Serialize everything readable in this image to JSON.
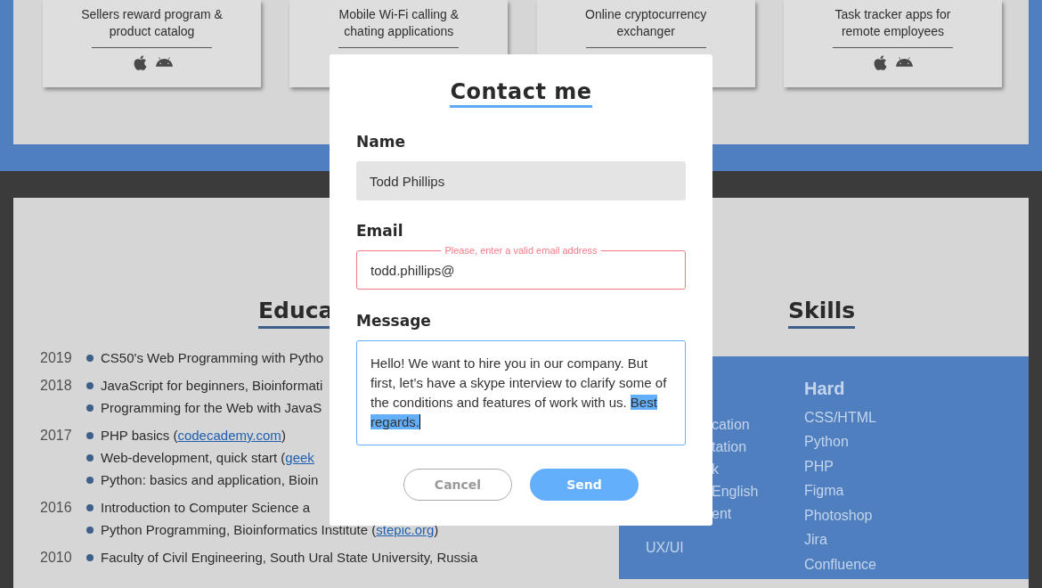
{
  "projects": [
    {
      "description": "Sellers reward program & product catalog",
      "platform_icons": true
    },
    {
      "description": "Mobile Wi-Fi calling & chating applications"
    },
    {
      "description": "Online cryptocurrency exchanger"
    },
    {
      "description": "Task tracker apps for remote employees",
      "platform_icons": true
    }
  ],
  "education": {
    "heading": "Educa",
    "entries": [
      {
        "year": "2019",
        "items": [
          {
            "text": "CS50's Web Programming with Pytho"
          }
        ]
      },
      {
        "year": "2018",
        "items": [
          {
            "text": "JavaScript for beginners, Bioinformati"
          },
          {
            "text": "Programming for the Web with JavaS"
          }
        ]
      },
      {
        "year": "2017",
        "items": [
          {
            "text": "PHP basics (",
            "link": "codecademy.com",
            "after": ")"
          },
          {
            "text": "Web-development, quick start (",
            "link": "geek"
          },
          {
            "text": "Python: basics and application, Bioin"
          }
        ]
      },
      {
        "year": "2016",
        "items": [
          {
            "text": "Introduction to Computer Science a"
          },
          {
            "text": "Python Programming, Bioinformatics Institute (",
            "link": "stepic.org",
            "after": ")"
          }
        ]
      },
      {
        "year": "2010",
        "items": [
          {
            "text": "Faculty of Civil Engineering, South Ural State University, Russia"
          }
        ]
      }
    ]
  },
  "skills": {
    "heading": "Skills",
    "soft": [
      {
        "text": "cation",
        "partial": true
      },
      {
        "text": "tation",
        "partial": true
      },
      {
        "text": "k",
        "partial": true
      },
      {
        "text": "English",
        "partial": true
      },
      {
        "text": "ent",
        "partial": true
      },
      {
        "text": "UX/UI",
        "partial": false
      }
    ],
    "hard_heading": "Hard",
    "hard": [
      "CSS/HTML",
      "Python",
      "PHP",
      "Figma",
      "Photoshop",
      "Jira",
      "Confluence"
    ]
  },
  "dialog": {
    "title": "Contact me",
    "name": {
      "label": "Name",
      "value": "Todd Phillips"
    },
    "email": {
      "label": "Email",
      "value": "todd.phillips@",
      "invalid": true,
      "error": "Please, enter a valid email address"
    },
    "message": {
      "label": "Message",
      "value": "Hello! We want to hire you in our company. But first, let’s have a skype interview to clarify some of the conditions and features of work with us. ",
      "selection": "Best regards."
    },
    "buttons": [
      {
        "label": "Cancel",
        "kind": "secondary"
      },
      {
        "label": "Send",
        "kind": "primary"
      }
    ]
  }
}
